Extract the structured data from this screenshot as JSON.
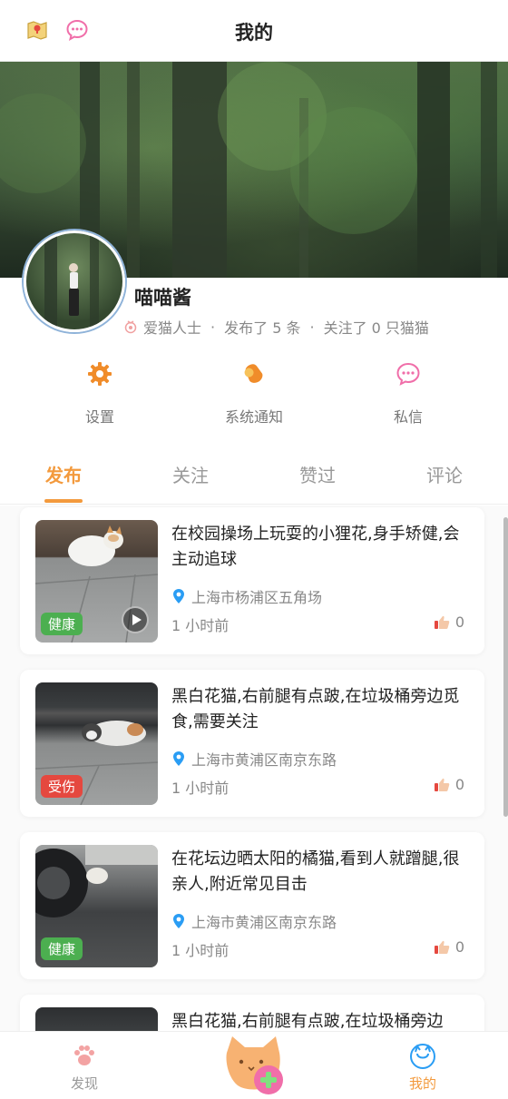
{
  "header": {
    "title": "我的"
  },
  "profile": {
    "name": "喵喵酱",
    "role": "爱猫人士",
    "posts": "发布了 5 条",
    "following": "关注了 0 只猫猫"
  },
  "quick_actions": [
    {
      "label": "设置",
      "icon": "gear-icon"
    },
    {
      "label": "系统通知",
      "icon": "bell-icon"
    },
    {
      "label": "私信",
      "icon": "chat-icon"
    }
  ],
  "tabs": [
    {
      "label": "发布",
      "active": true
    },
    {
      "label": "关注",
      "active": false
    },
    {
      "label": "赞过",
      "active": false
    },
    {
      "label": "评论",
      "active": false
    }
  ],
  "posts": [
    {
      "title": "在校园操场上玩耍的小狸花,身手矫健,会主动追球",
      "location": "上海市杨浦区五角场",
      "time": "1 小时前",
      "likes": "0",
      "badge": "健康",
      "badge_color": "#4caf50",
      "has_video": true
    },
    {
      "title": "黑白花猫,右前腿有点跛,在垃圾桶旁边觅食,需要关注",
      "location": "上海市黄浦区南京东路",
      "time": "1 小时前",
      "likes": "0",
      "badge": "受伤",
      "badge_color": "#e5483f",
      "has_video": false
    },
    {
      "title": "在花坛边晒太阳的橘猫,看到人就蹭腿,很亲人,附近常见目击",
      "location": "上海市黄浦区南京东路",
      "time": "1 小时前",
      "likes": "0",
      "badge": "健康",
      "badge_color": "#4caf50",
      "has_video": false
    },
    {
      "title": "黑白花猫,右前腿有点跛,在垃圾桶旁边",
      "location": "",
      "time": "",
      "likes": "",
      "badge": "",
      "badge_color": "",
      "has_video": false
    }
  ],
  "bottom_nav": [
    {
      "label": "发现",
      "icon": "paw-icon",
      "active": false
    },
    {
      "label": "我的",
      "icon": "cat-face-icon",
      "active": true
    }
  ],
  "colors": {
    "accent": "#f39a3d",
    "pink": "#f06ea9",
    "blue": "#2a9df4",
    "healthy": "#4caf50",
    "injured": "#e5483f"
  }
}
